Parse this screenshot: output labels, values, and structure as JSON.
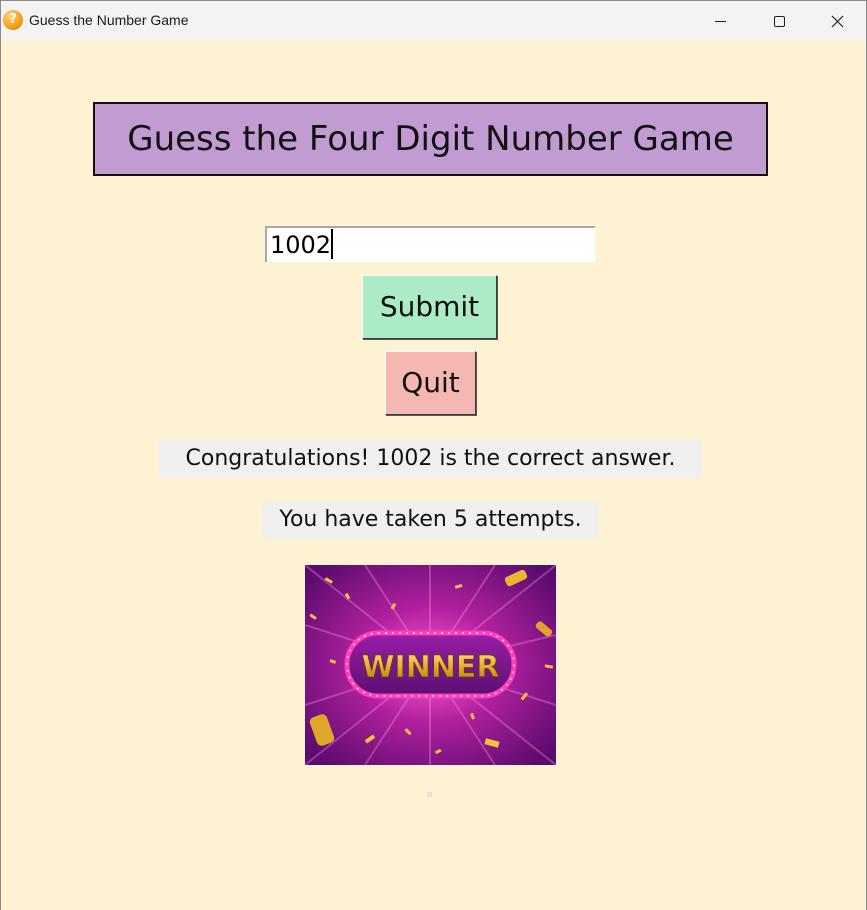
{
  "window": {
    "title": "Guess the Number Game",
    "app_icon_glyph": "?",
    "app_icon": "question-mark-icon",
    "controls": [
      "minimize-icon",
      "maximize-icon",
      "close-icon"
    ],
    "background_color": "#fdf3d2"
  },
  "game": {
    "heading": "Guess the Four Digit Number Game",
    "heading_bg": "#c39bd3",
    "guess_value": "1002",
    "submit_label": "Submit",
    "submit_color": "#abebc6",
    "quit_label": "Quit",
    "quit_color": "#f5b7b1",
    "result_message": "Congratulations! 1002 is the correct answer.",
    "attempts_message": "You have taken 5 attempts.",
    "winner_image_text": "WINNER"
  }
}
